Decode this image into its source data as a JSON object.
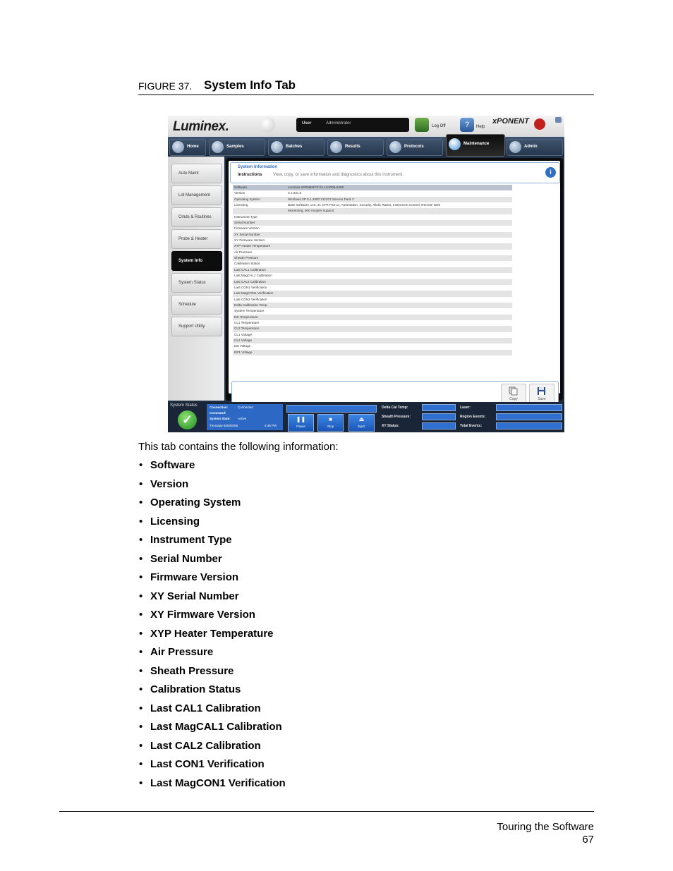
{
  "figure": {
    "number": "FIGURE 37.",
    "title": "System Info Tab"
  },
  "screenshot": {
    "logo": "Luminex.",
    "user_label": "User",
    "user_value": "Administrator",
    "logoff_label": "Log Off",
    "help_label": "Help",
    "brand": "xPONENT",
    "tabs": [
      "Home",
      "Samples",
      "Batches",
      "Results",
      "Protocols",
      "Maintenance",
      "Admin"
    ],
    "active_tab": "Maintenance",
    "sidebar": [
      "Auto Maint",
      "Lot Management",
      "Cmds & Routines",
      "Probe & Heater",
      "System Info",
      "System Status",
      "Schedule",
      "Support Utility"
    ],
    "active_side": "System Info",
    "header_title": "System Information",
    "instructions_label": "Instructions",
    "instructions_text": "View, copy, or save information and diagnostics about this instrument.",
    "rows": [
      {
        "k": "Software",
        "v": "Luminex xPONENT® for LX100/LX200"
      },
      {
        "k": "Version",
        "v": "3.1.931.0"
      },
      {
        "k": "Operating System",
        "v": "Windows XP 5.1.2600 131072 Service Pack 2"
      },
      {
        "k": "Licensing",
        "v": "Base Software, LIS, 21 CFR Part 11, Automation, Security, Allelic Ratios, Instrument Control, Remote Web"
      },
      {
        "k": "",
        "v": "Monitoring, 500 Analyte Support"
      },
      {
        "k": "Instrument Type",
        "v": ""
      },
      {
        "k": "Serial Number",
        "v": ""
      },
      {
        "k": "Firmware Version",
        "v": ""
      },
      {
        "k": "XY Serial Number",
        "v": ""
      },
      {
        "k": "XY Firmware Version",
        "v": ""
      },
      {
        "k": "XYP Heater Temperature",
        "v": ""
      },
      {
        "k": "Air Pressure",
        "v": ""
      },
      {
        "k": "Sheath Pressure",
        "v": ""
      },
      {
        "k": "Calibration Status",
        "v": ""
      },
      {
        "k": "Last CAL1 Calibration",
        "v": ""
      },
      {
        "k": "Last MagCAL1 Calibration",
        "v": ""
      },
      {
        "k": "Last CAL2 Calibration",
        "v": ""
      },
      {
        "k": "Last CON1 Verification",
        "v": ""
      },
      {
        "k": "Last MagCON1 Verification",
        "v": ""
      },
      {
        "k": "Last CON2 Verification",
        "v": ""
      },
      {
        "k": "Delta Calibration Temp",
        "v": ""
      },
      {
        "k": "System Temperature",
        "v": ""
      },
      {
        "k": "DD Temperature",
        "v": ""
      },
      {
        "k": "CL1 Temperature",
        "v": ""
      },
      {
        "k": "CL2 Temperature",
        "v": ""
      },
      {
        "k": "CL1 Voltage",
        "v": ""
      },
      {
        "k": "CL2 Voltage",
        "v": ""
      },
      {
        "k": "DD Voltage",
        "v": ""
      },
      {
        "k": "RP1 Voltage",
        "v": ""
      }
    ],
    "copy_label": "Copy",
    "save_label": "Save",
    "status": {
      "title": "System Status",
      "connection_label": "Connection:",
      "connection_value": "Connected",
      "command_label": "Command:",
      "command_value": "",
      "state_label": "System State:",
      "state_value": "Active",
      "date_value": "Thursday 8/28/2008",
      "time_value": "4:36 PM",
      "controls": [
        "Pause",
        "Stop",
        "Eject"
      ],
      "fields": [
        "Delta Cal Temp:",
        "Sheath Pressure:",
        "XY Status:",
        "Laser:",
        "Region Events:",
        "Total Events:"
      ]
    }
  },
  "caption": "This tab contains the following information:",
  "bullets": [
    "Software",
    "Version",
    "Operating System",
    "Licensing",
    "Instrument Type",
    "Serial Number",
    "Firmware Version",
    "XY Serial Number",
    "XY Firmware Version",
    "XYP Heater Temperature",
    "Air Pressure",
    "Sheath Pressure",
    "Calibration Status",
    "Last CAL1 Calibration",
    "Last MagCAL1 Calibration",
    "Last CAL2 Calibration",
    "Last CON1 Verification",
    "Last MagCON1 Verification"
  ],
  "footer": {
    "section": "Touring the Software",
    "page": "67"
  }
}
